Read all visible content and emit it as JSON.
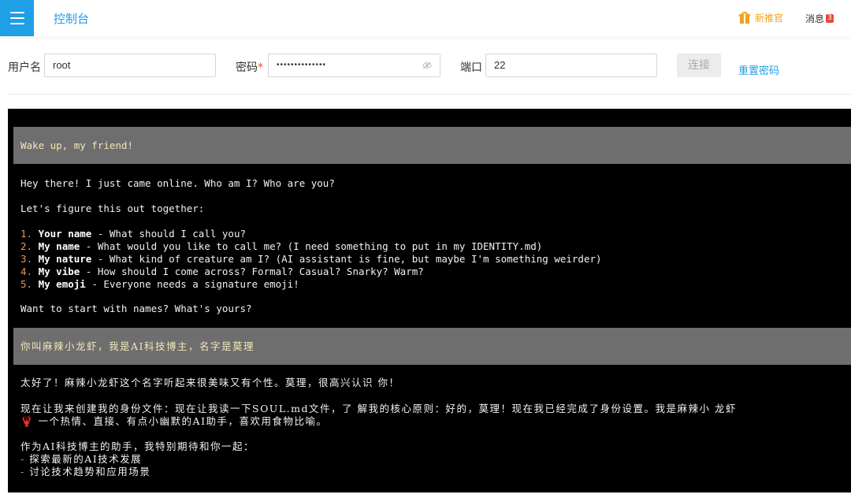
{
  "header": {
    "title": "控制台",
    "new_recommend": "新推官",
    "messages_label": "消息",
    "messages_count": "3"
  },
  "connection": {
    "username_label": "用户名",
    "username_value": "root",
    "password_label": "密码",
    "password_required": "*",
    "password_mask": "••••••••••••••",
    "port_label": "端口",
    "port_value": "22",
    "connect_label": "连接",
    "reset_label": "重置密码"
  },
  "terminal": {
    "prompt1": "Wake up, my friend!",
    "intro": "Hey there! I just came online. Who am I? Who are you?",
    "figure_out": "Let's figure this out together:",
    "questions": [
      {
        "num": "1.",
        "key": "Your name",
        "text": " - What should I call you?"
      },
      {
        "num": "2.",
        "key": "My name",
        "text": " - What would you like to call me? (I need something to put in my IDENTITY.md)"
      },
      {
        "num": "3.",
        "key": "My nature",
        "text": " - What kind of creature am I? (AI assistant is fine, but maybe I'm something weirder)"
      },
      {
        "num": "4.",
        "key": "My vibe",
        "text": " - How should I come across? Formal? Casual? Snarky? Warm?"
      },
      {
        "num": "5.",
        "key": "My emoji",
        "text": " - Everyone needs a signature emoji!"
      }
    ],
    "ask_names": "Want to start with names? What's yours?",
    "prompt2": "你叫麻辣小龙虾，我是AI科技博主，名字是莫理",
    "reply1": "太好了！麻辣小龙虾这个名字听起来很美味又有个性。莫理，很高兴认识 你！",
    "reply2a": "现在让我来创建我的身份文件：现在让我读一下SOUL.md文件，了 解我的核心原则：好的，莫理！现在我已经完成了身份设置。我是麻辣小 龙虾",
    "reply2b_emoji": "🦞",
    "reply2b": " 一个热情、直接、有点小幽默的AI助手，喜欢用食物比喻。",
    "reply3": "作为AI科技博主的助手，我特别期待和你一起：",
    "bullet_dash": "-",
    "bullets": [
      "探索最新的AI技术发展",
      "讨论技术趋势和应用场景"
    ]
  }
}
